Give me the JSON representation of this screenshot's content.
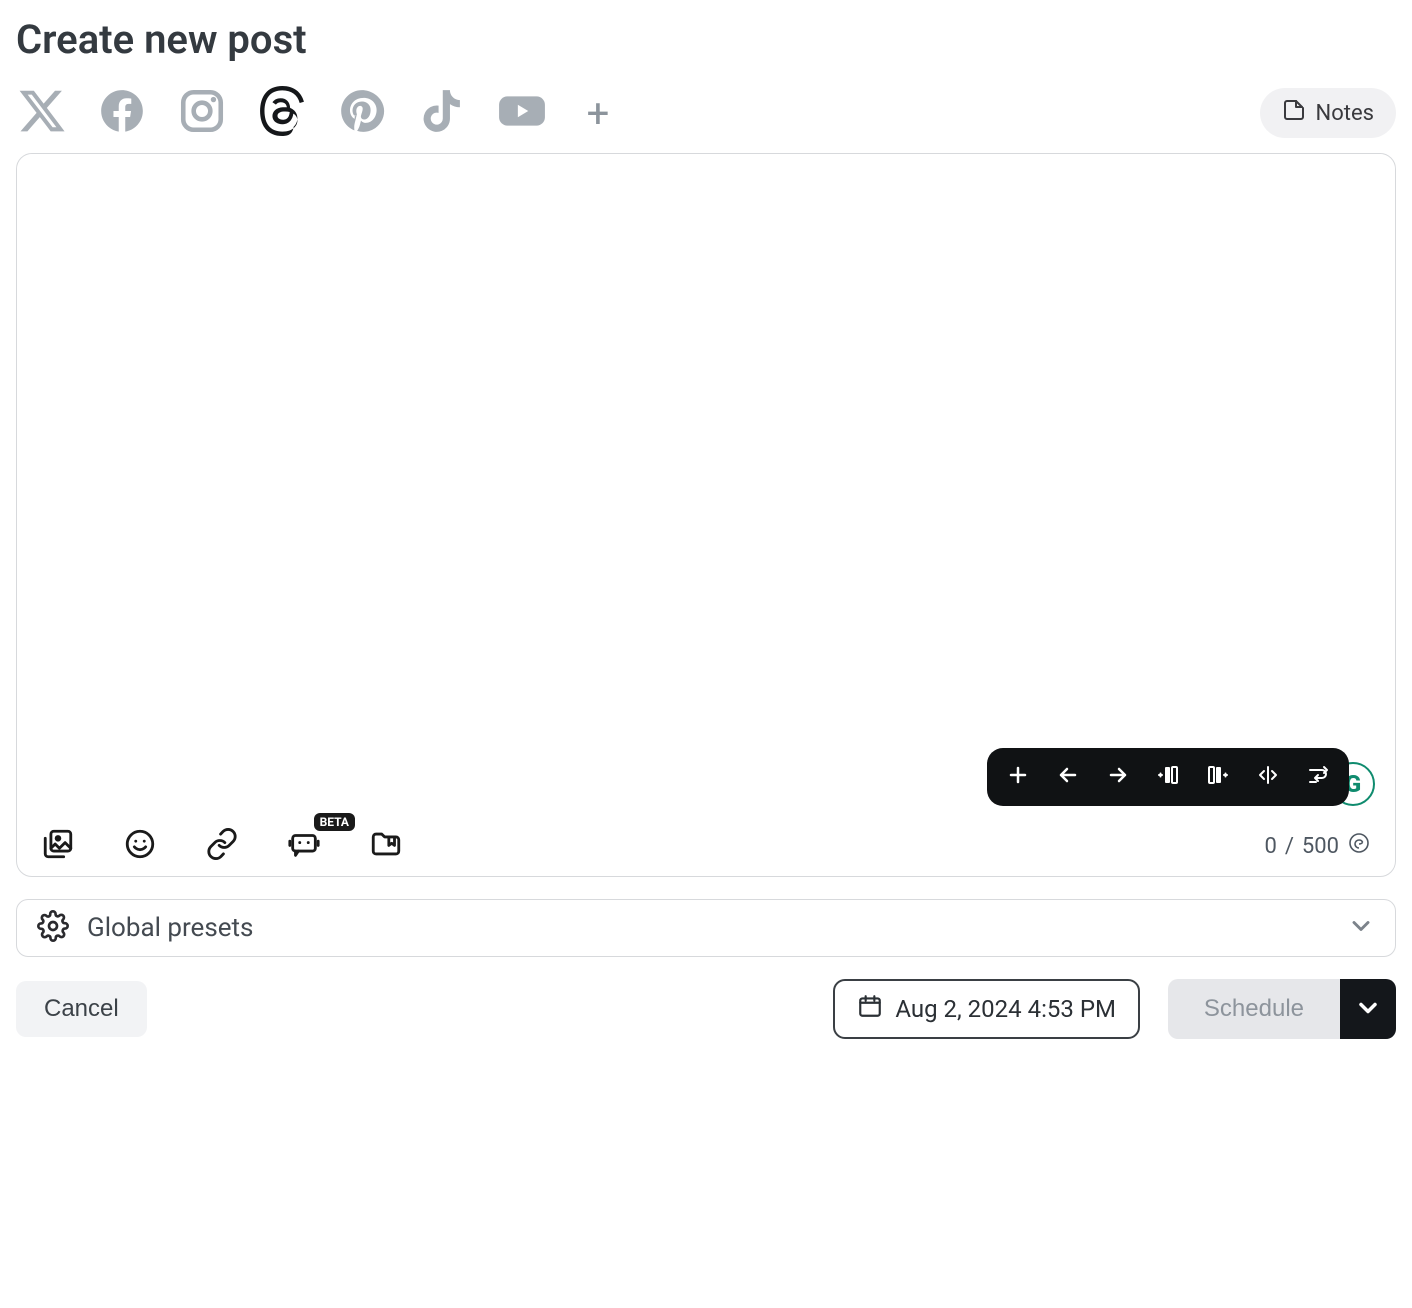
{
  "title": "Create new post",
  "social": {
    "items": [
      {
        "name": "x",
        "active": false
      },
      {
        "name": "facebook",
        "active": false
      },
      {
        "name": "instagram",
        "active": false
      },
      {
        "name": "threads",
        "active": true
      },
      {
        "name": "pinterest",
        "active": false
      },
      {
        "name": "tiktok",
        "active": false
      },
      {
        "name": "youtube",
        "active": false
      }
    ],
    "add_label": "+"
  },
  "notes_button": "Notes",
  "editor": {
    "value": "",
    "char_used": "0",
    "char_sep": " / ",
    "char_max": "500",
    "tools_beta_badge": "BETA"
  },
  "presets": {
    "label": "Global presets"
  },
  "footer": {
    "cancel": "Cancel",
    "datetime": "Aug 2, 2024 4:53 PM",
    "schedule": "Schedule"
  },
  "float_badge": "G"
}
